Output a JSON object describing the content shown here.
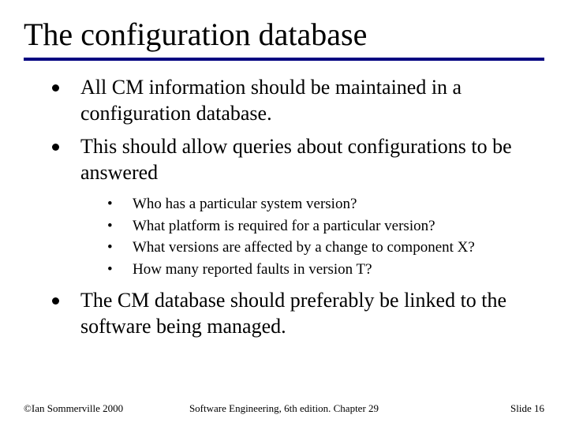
{
  "title": "The configuration database",
  "bullets": {
    "b1": "All CM information should be maintained in a configuration database.",
    "b2": "This should allow queries about configurations to be  answered",
    "b3": "The CM database should preferably be linked to the software being managed."
  },
  "sub": {
    "s1": "Who has a particular system version?",
    "s2": "What platform is required for a particular version?",
    "s3": "What versions are affected by a change to component X?",
    "s4": "How many reported faults in version T?"
  },
  "footer": {
    "left": "©Ian Sommerville 2000",
    "center": "Software Engineering, 6th edition. Chapter 29",
    "right": "Slide 16"
  }
}
